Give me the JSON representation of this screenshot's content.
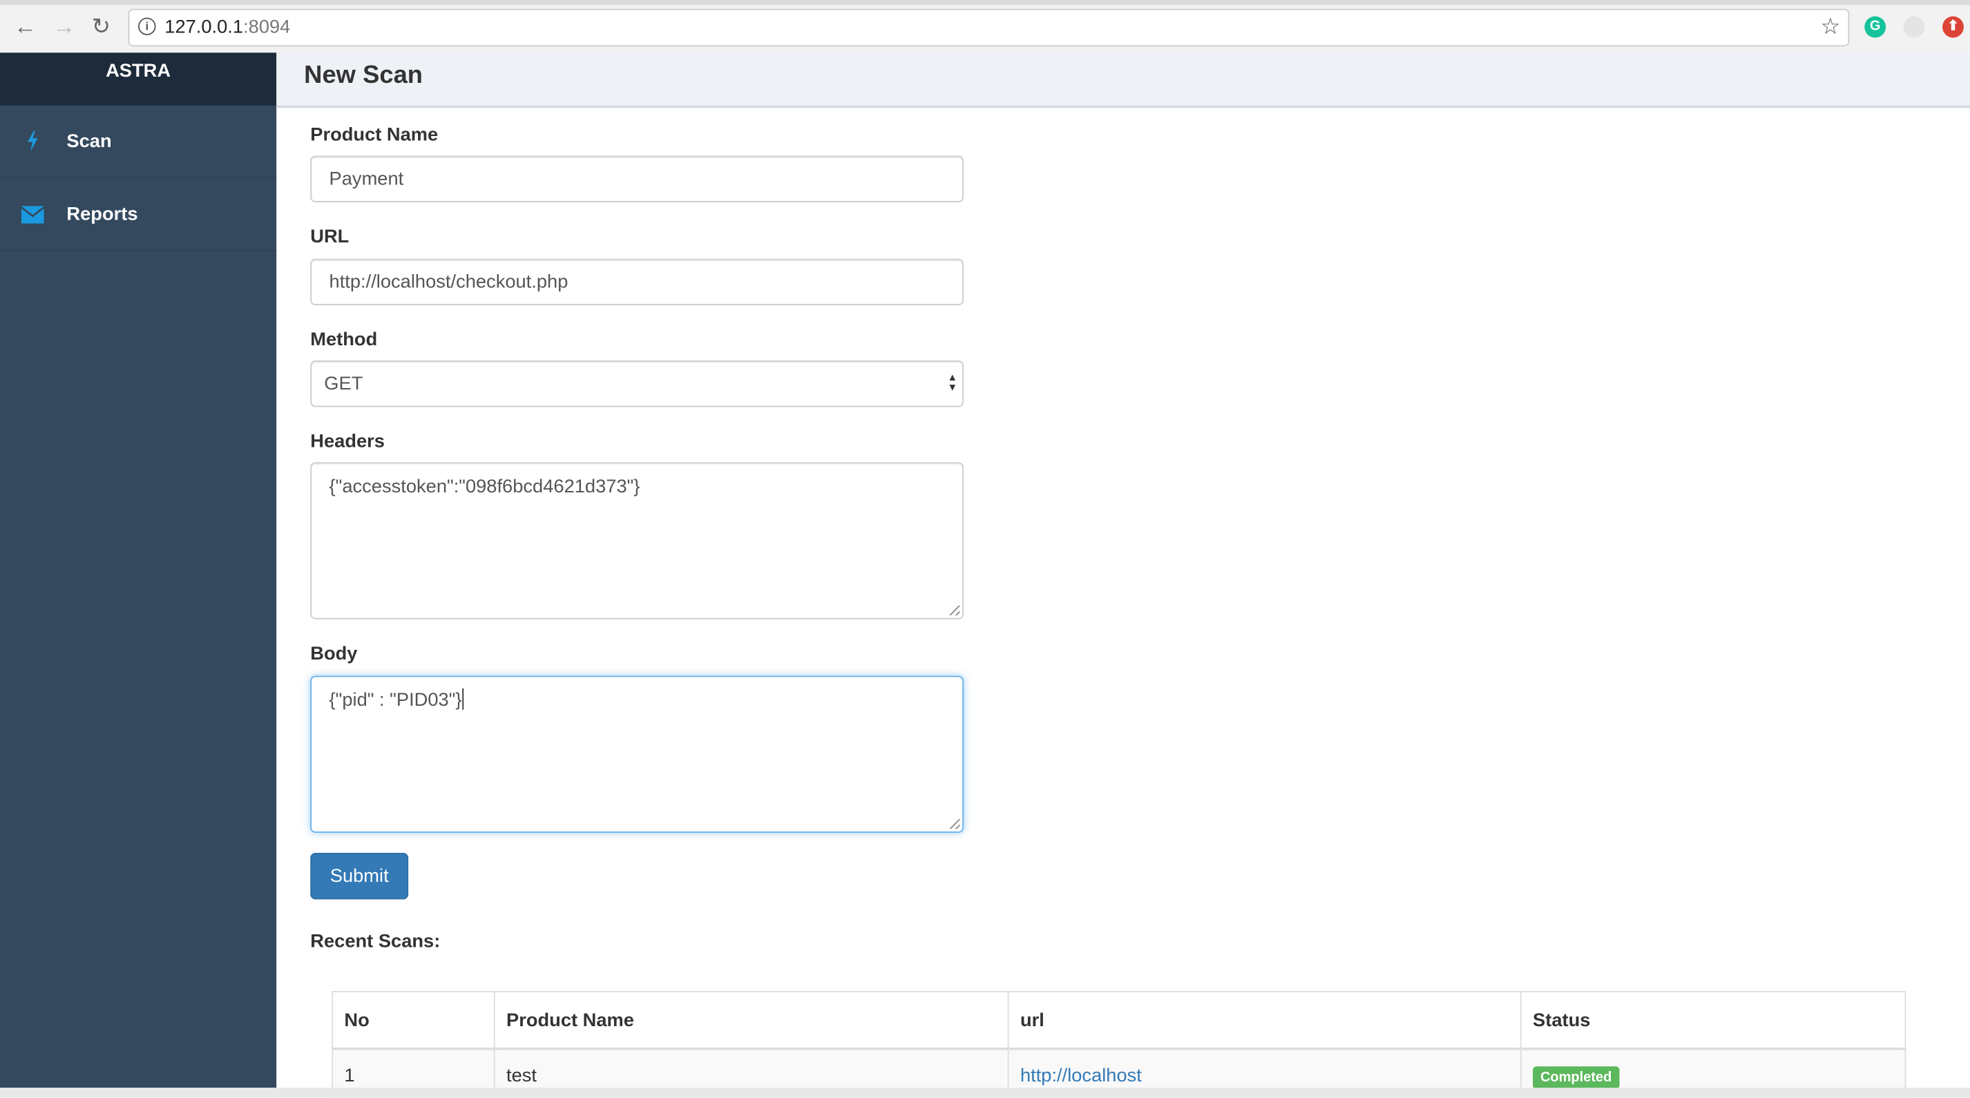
{
  "browser": {
    "url_host": "127.0.0.1",
    "url_port": ":8094",
    "back_icon": "arrow-left",
    "forward_icon": "arrow-right",
    "reload_icon": "reload",
    "bookmark_icon": "star",
    "extensions": [
      {
        "name": "grammarly",
        "color": "#15c39a",
        "glyph": "G"
      },
      {
        "name": "loading-extension",
        "color": "#dddddd",
        "glyph": ""
      },
      {
        "name": "upload-extension",
        "color": "#db4437",
        "glyph": "⬆"
      }
    ]
  },
  "sidebar": {
    "brand": "ASTRA",
    "items": [
      {
        "label": "Scan",
        "icon": "bolt"
      },
      {
        "label": "Reports",
        "icon": "envelope"
      }
    ]
  },
  "header": {
    "title": "New Scan"
  },
  "form": {
    "product_name": {
      "label": "Product Name",
      "value": "Payment"
    },
    "url": {
      "label": "URL",
      "value": "http://localhost/checkout.php"
    },
    "method": {
      "label": "Method",
      "value": "GET"
    },
    "headers": {
      "label": "Headers",
      "value": "{\"accesstoken\":\"098f6bcd4621d373\"}"
    },
    "body": {
      "label": "Body",
      "value": "{\"pid\" : \"PID03\"}"
    },
    "submit_label": "Submit"
  },
  "recent": {
    "title": "Recent Scans:",
    "columns": [
      "No",
      "Product Name",
      "url",
      "Status"
    ],
    "rows": [
      {
        "no": "1",
        "product": "test",
        "url": "http://localhost",
        "status": "Completed"
      }
    ]
  },
  "colors": {
    "primary": "#337ab7",
    "success": "#5cb85c",
    "sidebar": "#34495e",
    "accent": "#1a9ae0"
  }
}
